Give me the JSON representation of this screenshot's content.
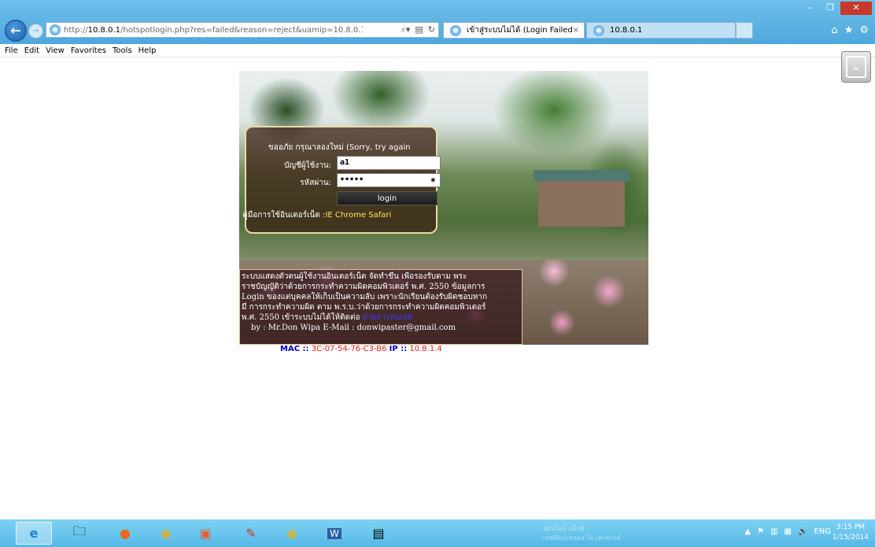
{
  "browser": {
    "address_url_prefix": "http://",
    "address_url_host": "10.8.0.1",
    "address_url_rest": "/hotspotlogin.php?res=failed&reason=reject&uamip=10.8.0.1&uamport=",
    "active_tab_title": "เข้าสู่ระบบไม่ได้ (Login Failed)",
    "inactive_tab_title": "10.8.0.1",
    "tab_close_glyph": "×",
    "menu": [
      "File",
      "Edit",
      "View",
      "Favorites",
      "Tools",
      "Help"
    ]
  },
  "portal": {
    "error_message": "ขออภัย กรุณาลองใหม่ (Sorry, try again",
    "username_label": "บัญชีผู้ใช้งาน:",
    "username_value": "a1",
    "password_label": "รหัสผ่าน:",
    "password_value": "•••••",
    "login_button": "login",
    "manual_label": "คู่มือการใช้อินเตอร์เน็ต :",
    "manual_links": "IE Chrome Safari",
    "info_lines": [
      "ระบบแสดงตัวตนผู้ใช้งานอินเตอร์เน็ต จัดทำขึ้น เพื่อรองรับตาม พระ",
      "ราชบัญญัติว่าด้วยการกระทำความผิดคอมพิวเตอร์ พ.ศ. 2550 ข้อมูลการ",
      "Login ของแต่บุคคลให้เก็บเป็นความลับ เพราะนักเรียนต้องรับผิดชอบหาก",
      "มี การกระทำความผิด ตาม พ.ร.บ.ว่าด้วยการกระทำความผิดคอมพิวเตอร์",
      "พ.ศ. 2550 เข้าระบบไม่ได้ให้ติดต่อ "
    ],
    "info_contact": "ฝ่ายสารสนเทศ",
    "info_by": "by : Mr.Don Wipa E-Mail : donwipaster@gmail.com",
    "mac_key": "MAC ::",
    "mac_value": "3C-07-54-76-C3-B6",
    "ip_key": "IP ::",
    "ip_value": "10.8.1.4"
  },
  "taskbar": {
    "language": "ENG",
    "time": "3:15 PM",
    "date": "1/15/2014",
    "ghost_line1": "ออนไลน์ แม็กซ์",
    "ghost_line2": "เลขศิลปะหอมล โอ้ เลกครรด์"
  }
}
